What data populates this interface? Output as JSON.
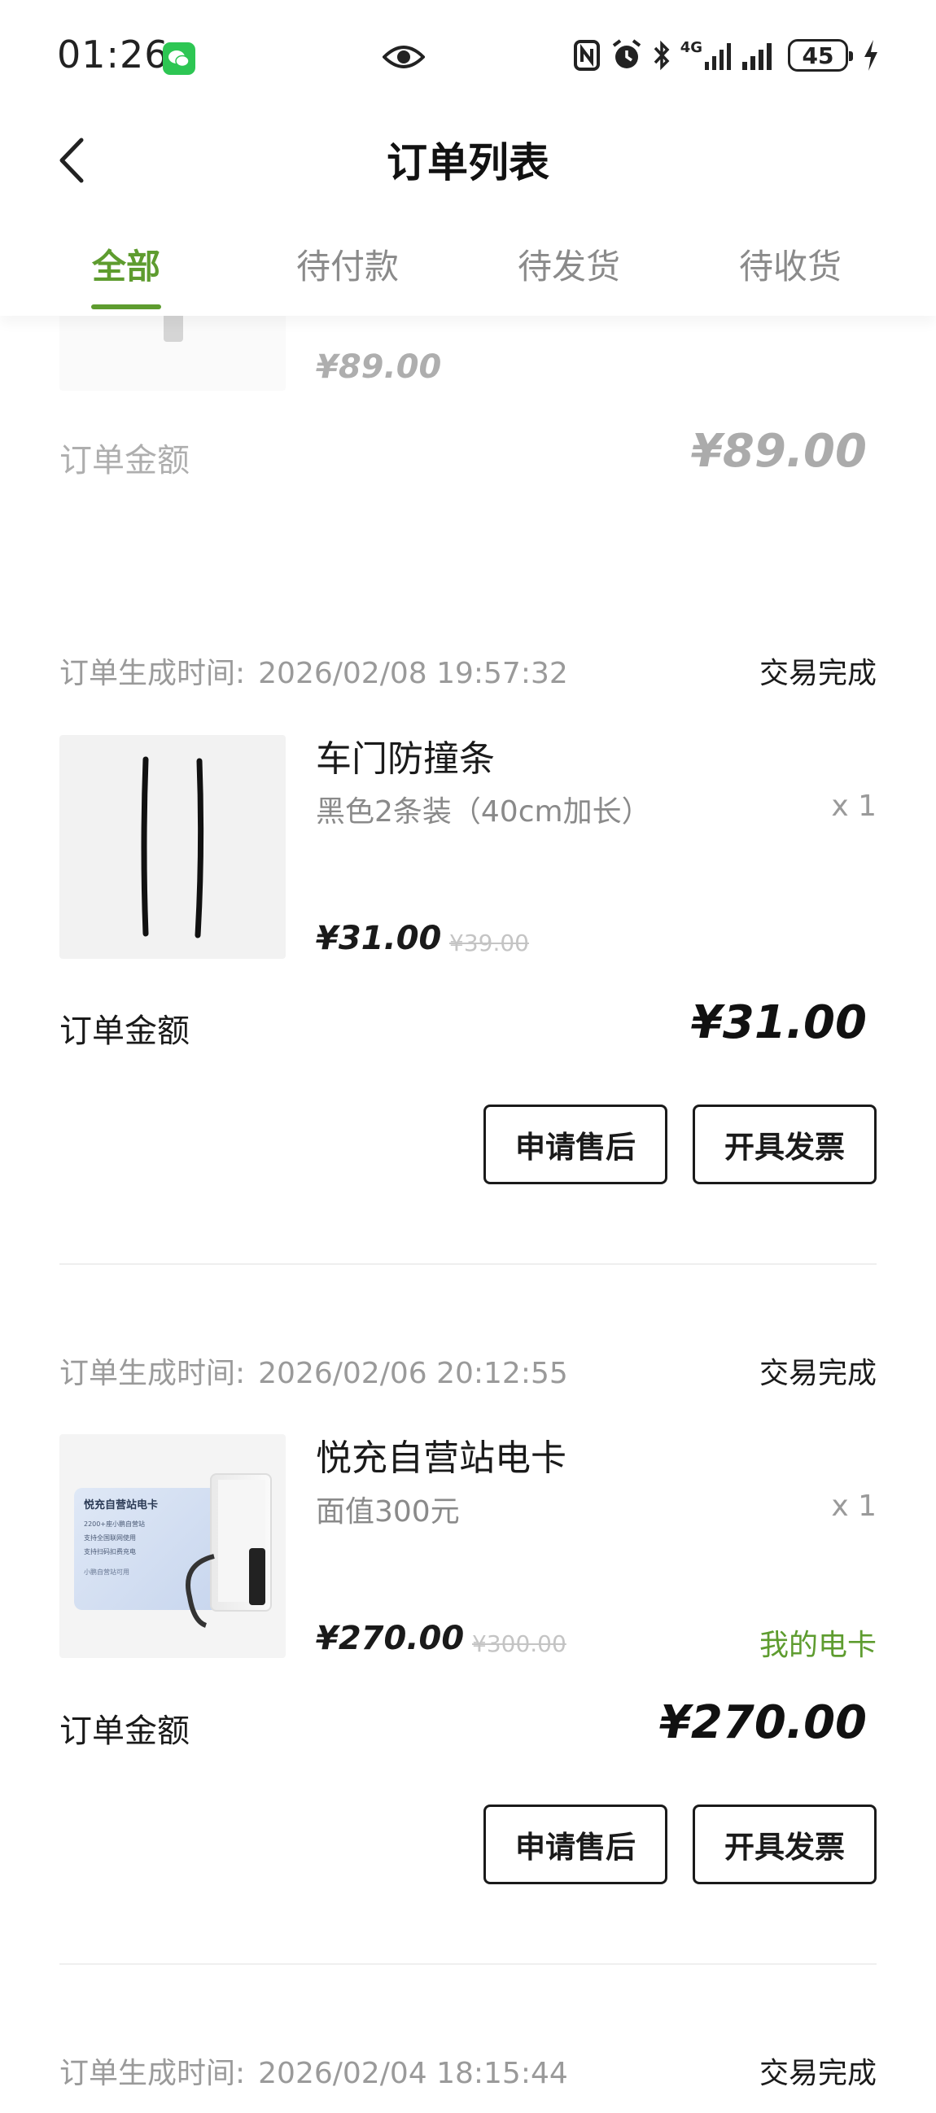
{
  "status_bar": {
    "time": "01:26",
    "battery": "45",
    "icons": [
      "wechat-icon",
      "eye-icon",
      "nfc-icon",
      "alarm-icon",
      "bluetooth-icon",
      "signal-4g-icon",
      "signal-icon",
      "battery-icon",
      "charging-icon"
    ],
    "signal_label": "4G"
  },
  "header": {
    "title": "订单列表",
    "back_icon": "chevron-left-icon"
  },
  "tabs": [
    {
      "label": "全部",
      "active": true
    },
    {
      "label": "待付款",
      "active": false
    },
    {
      "label": "待发货",
      "active": false
    },
    {
      "label": "待收货",
      "active": false
    }
  ],
  "partial_order": {
    "price": "¥89.00",
    "amount_label": "订单金额",
    "amount": "¥89.00"
  },
  "orders": [
    {
      "time_label": "订单生成时间:",
      "time": "2026/02/08 19:57:32",
      "status": "交易完成",
      "product_name": "车门防撞条",
      "spec": "黑色2条装（40cm加长）",
      "qty": "x 1",
      "price": "¥31.00",
      "original_price": "¥39.00",
      "amount_label": "订单金额",
      "amount": "¥31.00",
      "buttons": [
        "申请售后",
        "开具发票"
      ]
    },
    {
      "time_label": "订单生成时间:",
      "time": "2026/02/06 20:12:55",
      "status": "交易完成",
      "product_name": "悦充自营站电卡",
      "spec": "面值300元",
      "qty": "x 1",
      "price": "¥270.00",
      "original_price": "¥300.00",
      "link": "我的电卡",
      "amount_label": "订单金额",
      "amount": "¥270.00",
      "buttons": [
        "申请售后",
        "开具发票"
      ],
      "card_image": {
        "title": "悦充自营站电卡",
        "line1": "2200+座小鹏自营站",
        "line2": "支持全国联网使用",
        "line3": "支持扫码扣费充电",
        "footer": "小鹏自营站可用"
      }
    },
    {
      "time_label": "订单生成时间:",
      "time": "2026/02/04 18:15:44",
      "status": "交易完成"
    }
  ],
  "colors": {
    "accent": "#5e9c2f",
    "text": "#1a1a1a",
    "muted": "#9a9a9a"
  }
}
